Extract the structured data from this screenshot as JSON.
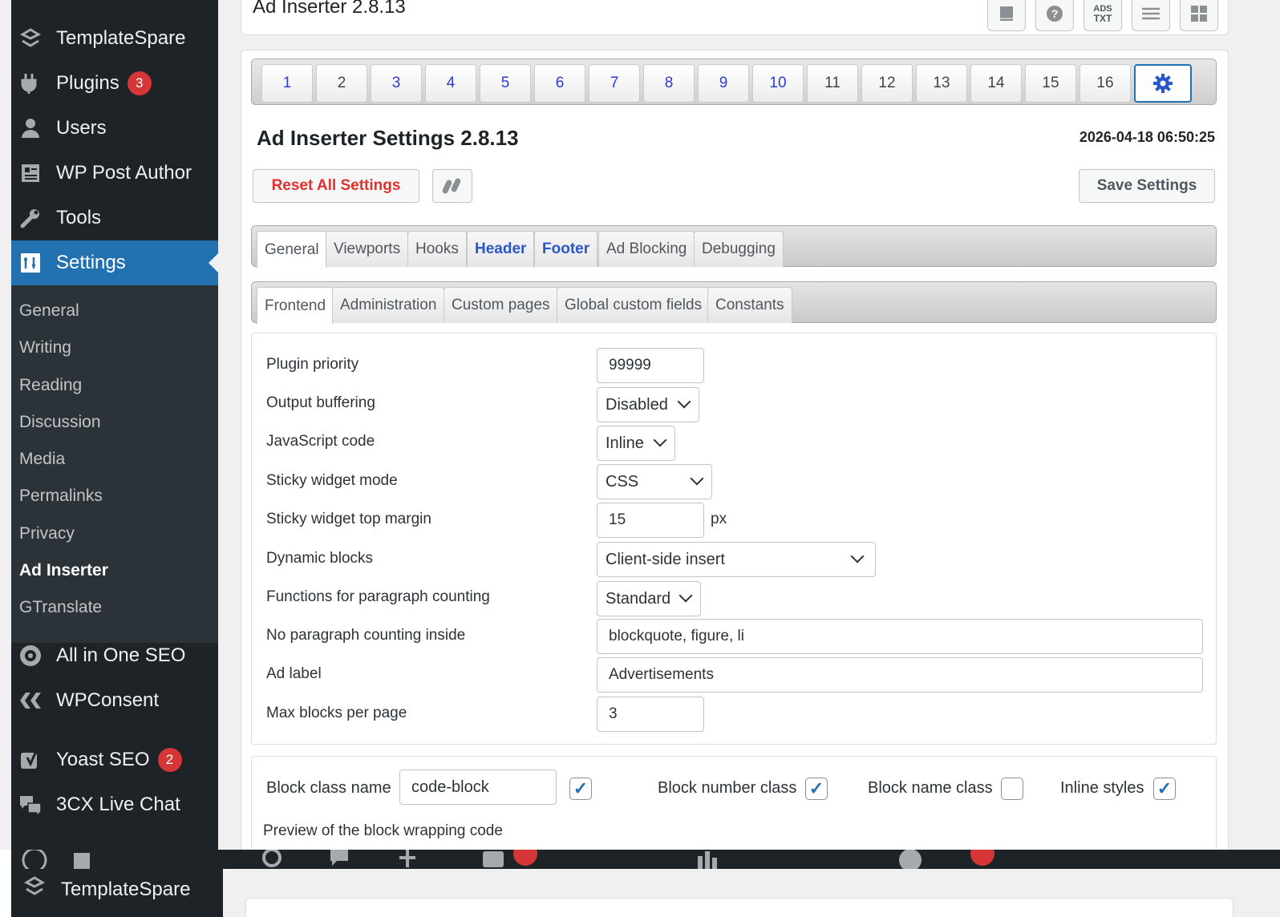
{
  "sidebar": {
    "menu": [
      {
        "label": "TemplateSpare",
        "icon": "templatespare-icon"
      },
      {
        "label": "Plugins",
        "icon": "plugins-icon",
        "badge": "3"
      },
      {
        "label": "Users",
        "icon": "users-icon"
      },
      {
        "label": "WP Post Author",
        "icon": "post-author-icon"
      },
      {
        "label": "Tools",
        "icon": "tools-icon"
      },
      {
        "label": "Settings",
        "icon": "settings-icon"
      }
    ],
    "submenu": [
      "General",
      "Writing",
      "Reading",
      "Discussion",
      "Media",
      "Permalinks",
      "Privacy",
      "Ad Inserter",
      "GTranslate"
    ],
    "menu_lower": [
      {
        "label": "All in One SEO",
        "icon": "aioseo-icon"
      },
      {
        "label": "WPConsent",
        "icon": "wpconsent-icon"
      },
      {
        "label": "Yoast SEO",
        "icon": "yoast-icon",
        "badge": "2"
      },
      {
        "label": "3CX Live Chat",
        "icon": "live-chat-icon"
      }
    ]
  },
  "header": {
    "title": "Ad Inserter 2.8.13",
    "buttons": [
      {
        "name": "documentation-icon",
        "glyph": "▮"
      },
      {
        "name": "help-icon",
        "glyph": "?"
      },
      {
        "name": "ads-txt-icon",
        "glyph": "TXT"
      },
      {
        "name": "list-view-icon",
        "glyph": "☰"
      },
      {
        "name": "grid-view-icon",
        "glyph": "▦"
      }
    ]
  },
  "block_tabs": [
    "1",
    "2",
    "3",
    "4",
    "5",
    "6",
    "7",
    "8",
    "9",
    "10",
    "11",
    "12",
    "13",
    "14",
    "15",
    "16"
  ],
  "settings": {
    "title": "Ad Inserter Settings 2.8.13",
    "datetime": "2026-04-18 06:50:25",
    "reset_label": "Reset All Settings",
    "save_label": "Save Settings"
  },
  "main_tabs": [
    "General",
    "Viewports",
    "Hooks",
    "Header",
    "Footer",
    "Ad Blocking",
    "Debugging"
  ],
  "sub_tabs": [
    "Frontend",
    "Administration",
    "Custom pages",
    "Global custom fields",
    "Constants"
  ],
  "form": {
    "plugin_priority": {
      "label": "Plugin priority",
      "value": "99999"
    },
    "output_buffering": {
      "label": "Output buffering",
      "value": "Disabled"
    },
    "javascript_code": {
      "label": "JavaScript code",
      "value": "Inline"
    },
    "sticky_widget_mode": {
      "label": "Sticky widget mode",
      "value": "CSS"
    },
    "sticky_widget_top_margin": {
      "label": "Sticky widget top margin",
      "value": "15",
      "unit": "px"
    },
    "dynamic_blocks": {
      "label": "Dynamic blocks",
      "value": "Client-side insert"
    },
    "paragraph_counting": {
      "label": "Functions for paragraph counting",
      "value": "Standard"
    },
    "no_paragraph_counting_inside": {
      "label": "No paragraph counting inside",
      "value": "blockquote, figure, li"
    },
    "ad_label": {
      "label": "Ad label",
      "value": "Advertisements"
    },
    "max_blocks": {
      "label": "Max blocks per page",
      "value": "3"
    }
  },
  "class_panel": {
    "block_class_name_label": "Block class name",
    "block_class_name_value": "code-block",
    "block_class_checked": true,
    "block_number_class_label": "Block number class",
    "block_number_class_checked": true,
    "block_name_class_label": "Block name class",
    "block_name_class_checked": false,
    "inline_styles_label": "Inline styles",
    "inline_styles_checked": true,
    "preview_label": "Preview of the block wrapping code"
  },
  "bottom_strip": {
    "sidebar_item": "TemplateSpare"
  },
  "colors": {
    "admin_dark": "#1d2327",
    "submenu_bg": "#2c3338",
    "active_blue": "#2271b1",
    "tab_blue_text": "#2b58c9",
    "reset_red": "#e0322e",
    "badge_red": "#d63638"
  }
}
